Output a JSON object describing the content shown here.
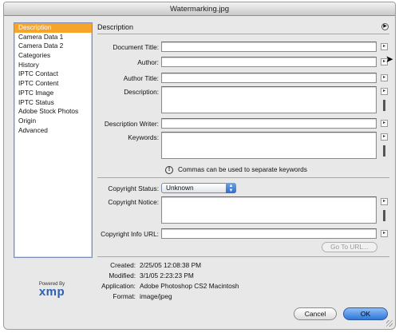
{
  "window": {
    "title": "Watermarking.jpg"
  },
  "sidebar": {
    "items": [
      {
        "label": "Description",
        "selected": true
      },
      {
        "label": "Camera Data 1"
      },
      {
        "label": "Camera Data 2"
      },
      {
        "label": "Categories"
      },
      {
        "label": "History"
      },
      {
        "label": "IPTC Contact"
      },
      {
        "label": "IPTC Content"
      },
      {
        "label": "IPTC Image"
      },
      {
        "label": "IPTC Status"
      },
      {
        "label": "Adobe Stock Photos"
      },
      {
        "label": "Origin"
      },
      {
        "label": "Advanced"
      }
    ]
  },
  "main": {
    "section_title": "Description",
    "fields": {
      "document_title": {
        "label": "Document Title:",
        "value": ""
      },
      "author": {
        "label": "Author:",
        "value": ""
      },
      "author_title": {
        "label": "Author Title:",
        "value": ""
      },
      "description": {
        "label": "Description:",
        "value": ""
      },
      "description_writer": {
        "label": "Description Writer:",
        "value": ""
      },
      "keywords": {
        "label": "Keywords:",
        "value": ""
      }
    },
    "keywords_hint": "Commas can be used to separate keywords",
    "copyright": {
      "status_label": "Copyright Status:",
      "status_value": "Unknown",
      "notice_label": "Copyright Notice:",
      "notice_value": "",
      "url_label": "Copyright Info URL:",
      "url_value": "",
      "goto_label": "Go To URL..."
    },
    "info": {
      "created_label": "Created:",
      "created_value": "2/25/05 12:08:38 PM",
      "modified_label": "Modified:",
      "modified_value": "3/1/05 2:23:23 PM",
      "application_label": "Application:",
      "application_value": "Adobe Photoshop CS2 Macintosh",
      "format_label": "Format:",
      "format_value": "image/jpeg"
    }
  },
  "logo": {
    "powered_by": "Powered By",
    "name": "xmp"
  },
  "buttons": {
    "cancel": "Cancel",
    "ok": "OK"
  },
  "colors": {
    "selection": "#f7a52a",
    "default_button": "#2f77d8",
    "logo": "#2c5fb5"
  },
  "icons": {
    "section_menu": "circle-arrow-icon",
    "field_menu": "triangle-right-icon",
    "hint": "exclamation-icon",
    "select_arrows": "updown-arrows-icon"
  }
}
